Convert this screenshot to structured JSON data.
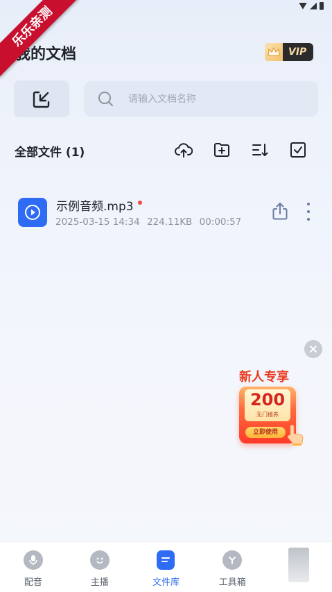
{
  "ribbon": {
    "text": "乐乐亲测"
  },
  "header": {
    "title": "我的文档",
    "vip_label": "VIP"
  },
  "search": {
    "placeholder": "请输入文档名称"
  },
  "files": {
    "heading": "全部文件 (1)",
    "items": [
      {
        "name": "示例音频.mp3",
        "date": "2025-03-15 14:34",
        "size": "224.11KB",
        "duration": "00:00:57",
        "icon": "play-icon",
        "unread": true
      }
    ]
  },
  "toolbar": {
    "icons": [
      "cloud-upload-icon",
      "new-folder-icon",
      "sort-icon",
      "select-checkbox-icon"
    ]
  },
  "promo": {
    "title": "新人专享",
    "amount": "200",
    "subtitle": "无门槛券",
    "button_label": "立即使用"
  },
  "tabs": [
    {
      "label": "配音",
      "icon": "microphone-icon",
      "active": false
    },
    {
      "label": "主播",
      "icon": "face-icon",
      "active": false
    },
    {
      "label": "文件库",
      "icon": "file-library-icon",
      "active": true
    },
    {
      "label": "工具箱",
      "icon": "toolbox-icon",
      "active": false
    }
  ],
  "colors": {
    "accent": "#2f6cf6",
    "ribbon": "#c8102e",
    "promo_red": "#ea3a1e",
    "unread_dot": "#f04848"
  }
}
